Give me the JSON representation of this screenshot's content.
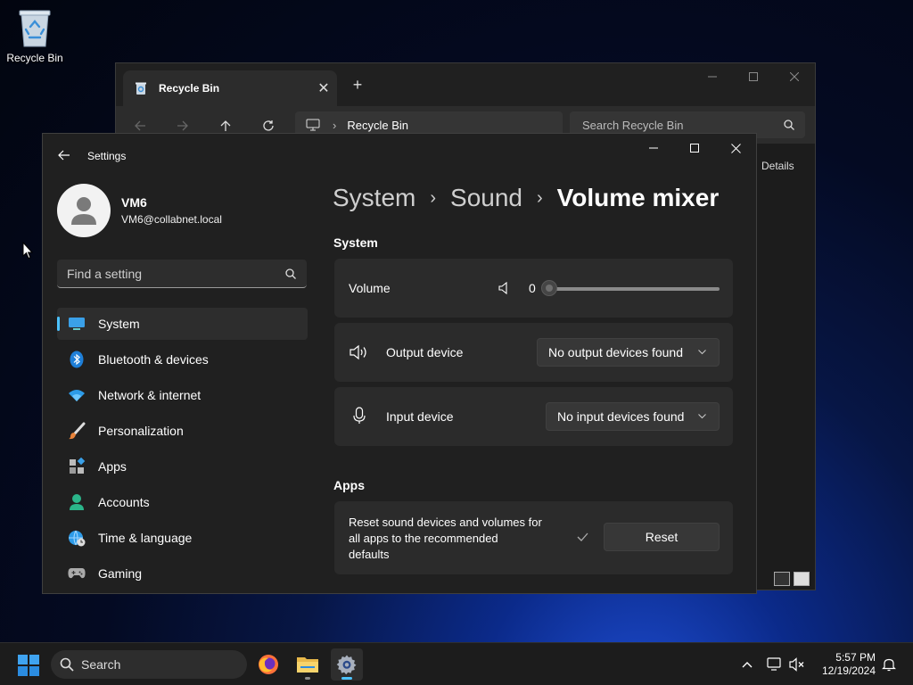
{
  "desktop": {
    "recycle_bin_label": "Recycle Bin"
  },
  "explorer": {
    "tab_title": "Recycle Bin",
    "address": "Recycle Bin",
    "search_placeholder": "Search Recycle Bin",
    "details_label": "Details"
  },
  "settings": {
    "app_title": "Settings",
    "user": {
      "name": "VM6",
      "email": "VM6@collabnet.local"
    },
    "find_placeholder": "Find a setting",
    "nav": [
      {
        "label": "System",
        "icon": "monitor-icon",
        "active": true
      },
      {
        "label": "Bluetooth & devices",
        "icon": "bluetooth-icon"
      },
      {
        "label": "Network & internet",
        "icon": "wifi-icon"
      },
      {
        "label": "Personalization",
        "icon": "brush-icon"
      },
      {
        "label": "Apps",
        "icon": "apps-icon"
      },
      {
        "label": "Accounts",
        "icon": "person-icon"
      },
      {
        "label": "Time & language",
        "icon": "globe-clock-icon"
      },
      {
        "label": "Gaming",
        "icon": "gamepad-icon"
      }
    ],
    "breadcrumb": {
      "level1": "System",
      "level2": "Sound",
      "current": "Volume mixer"
    },
    "system_section": {
      "heading": "System",
      "volume_label": "Volume",
      "volume_value": "0",
      "volume_level": 0,
      "output_label": "Output device",
      "output_value": "No output devices found",
      "input_label": "Input device",
      "input_value": "No input devices found"
    },
    "apps_section": {
      "heading": "Apps",
      "reset_text_line1": "Reset sound devices and volumes for",
      "reset_text_line2": "all apps to the recommended",
      "reset_text_line3": "defaults",
      "reset_button": "Reset"
    }
  },
  "taskbar": {
    "search_label": "Search",
    "time": "5:57 PM",
    "date": "12/19/2024"
  },
  "colors": {
    "accent": "#4cc2ff",
    "window_bg": "#202020",
    "card_bg": "#2b2b2b"
  }
}
